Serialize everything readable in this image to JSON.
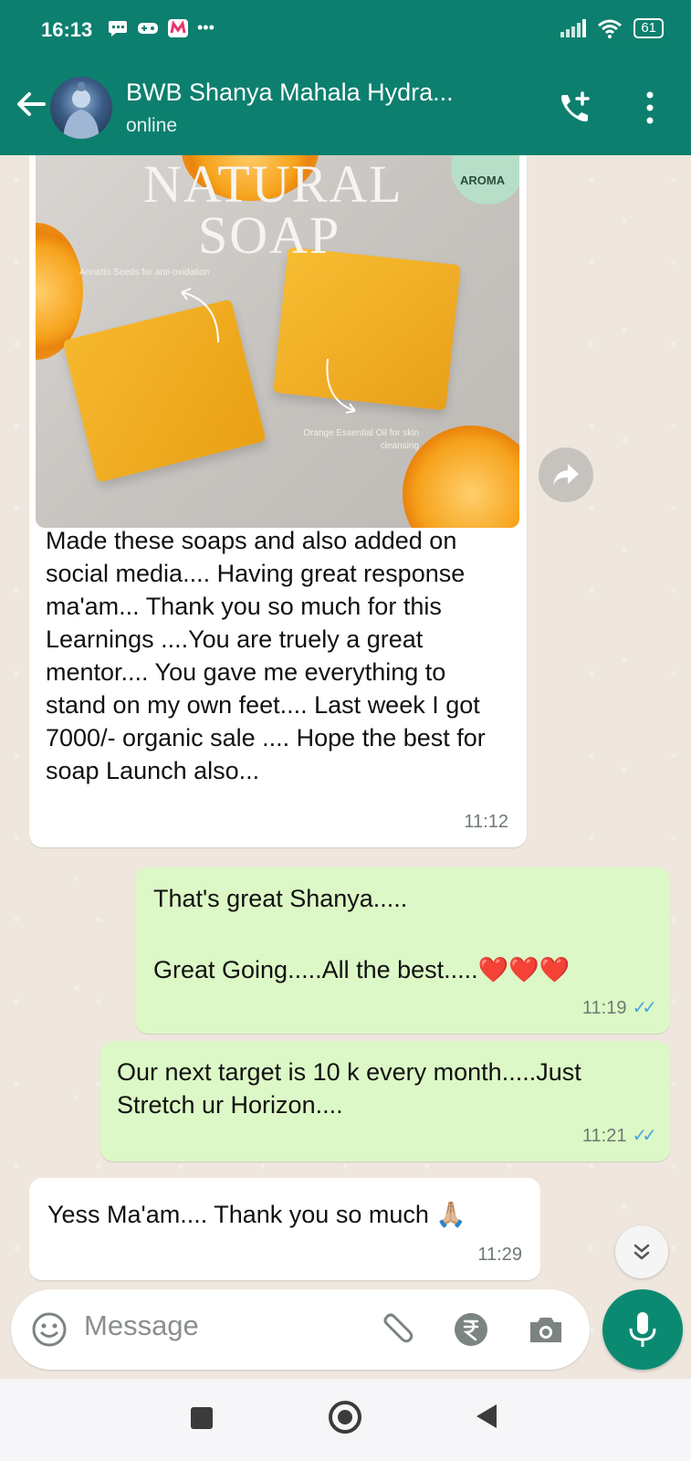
{
  "status_bar": {
    "time": "16:13",
    "battery": "61"
  },
  "header": {
    "contact_name": "BWB Shanya Mahala Hydra...",
    "status": "online"
  },
  "image_message": {
    "image_overlay": {
      "title_line1": "NATURAL",
      "title_line2": "SOAP",
      "badge": "AROMA",
      "note_left": "Annatto Seeds for anti-oxidation",
      "note_right": "Orange Essential Oil for skin cleansing"
    },
    "caption": "Made these soaps and also added on social media.... Having great response ma'am...   Thank you so much for this Learnings ....You are truely a great mentor.... You gave me everything to stand on my own feet.... Last week I got 7000/- organic sale .... Hope the best for soap Launch also...",
    "time": "11:12"
  },
  "messages": [
    {
      "direction": "out",
      "text_line1": "That's great Shanya.....",
      "text_line2": "Great Going.....All the best.....❤️❤️❤️",
      "time": "11:19"
    },
    {
      "direction": "out",
      "text": "Our next target is 10 k every month.....Just Stretch ur Horizon....",
      "time": "11:21"
    },
    {
      "direction": "in",
      "text": "Yess Ma'am.... Thank you so much 🙏🏼",
      "time": "11:29"
    }
  ],
  "input": {
    "placeholder": "Message"
  },
  "colors": {
    "header": "#0d7f6e",
    "outgoing_bubble": "#dcf8c6",
    "incoming_bubble": "#ffffff",
    "ticks": "#4fa3e0",
    "mic_button": "#0b8a72"
  }
}
